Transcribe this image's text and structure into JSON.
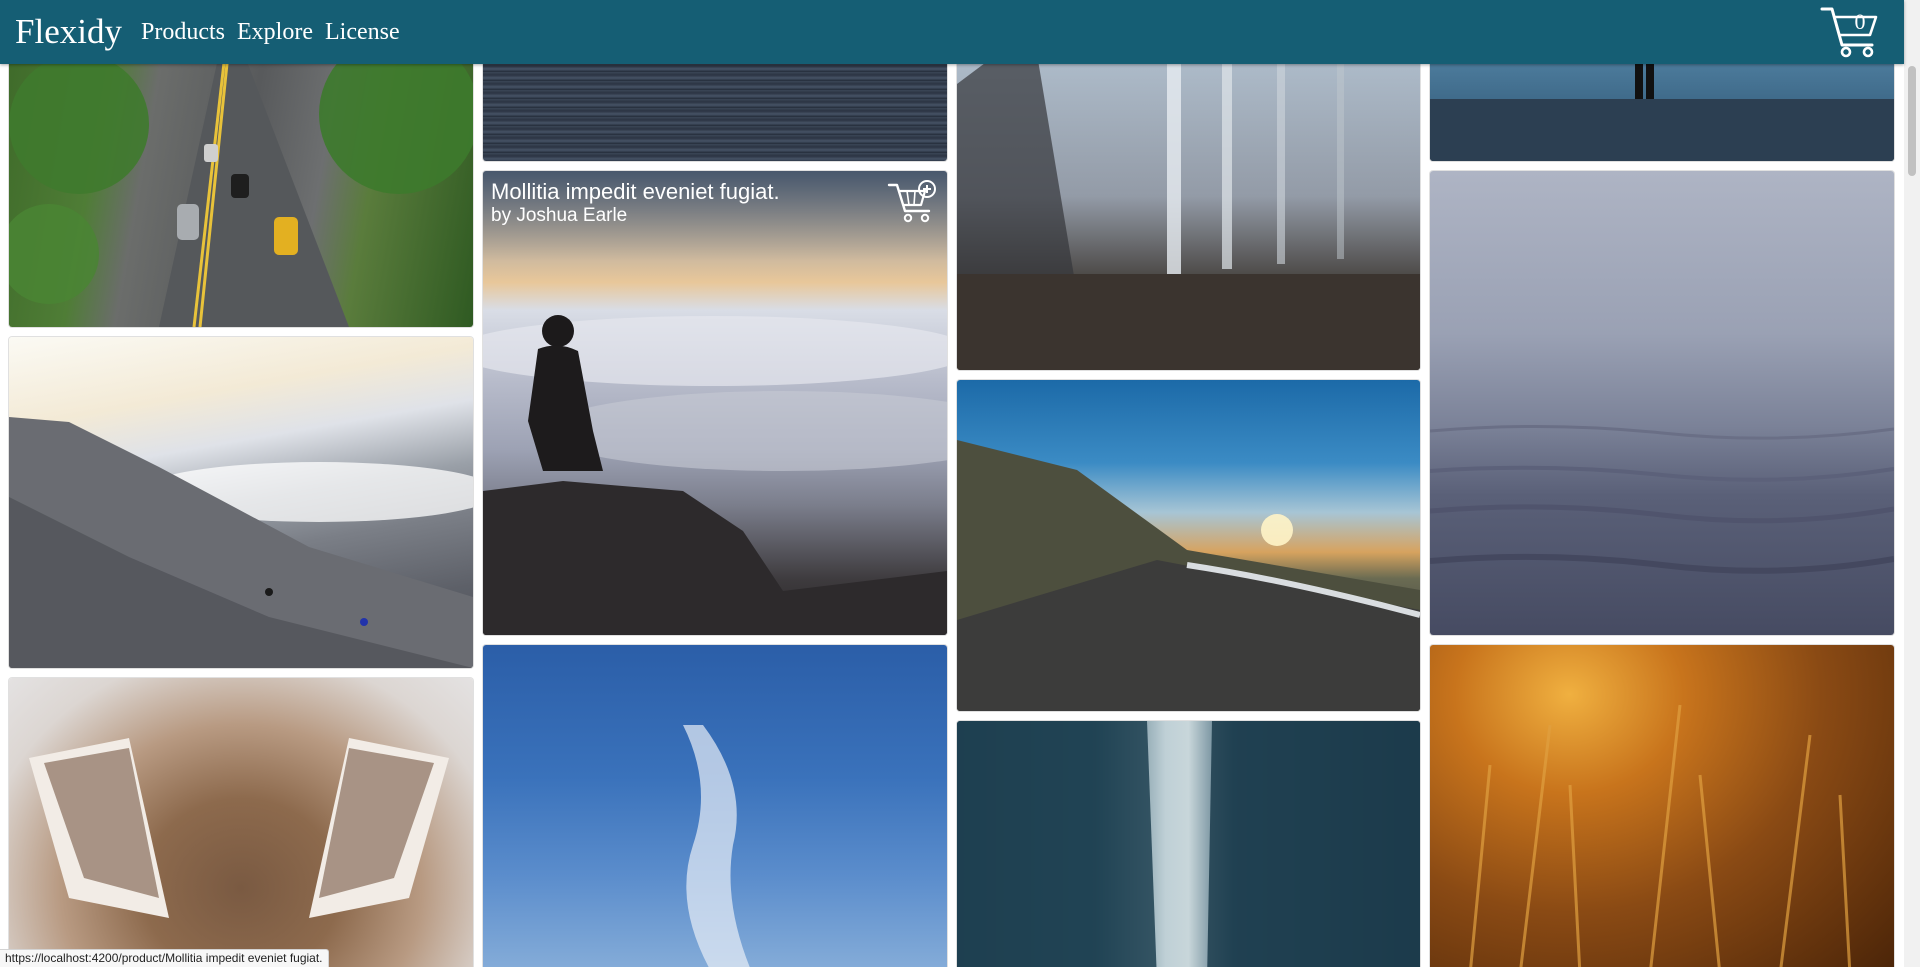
{
  "header": {
    "brand": "Flexidy",
    "nav": [
      "Products",
      "Explore",
      "License"
    ],
    "cart_count": "0",
    "background": "#155e74"
  },
  "gallery": {
    "featured_tile": {
      "title": "Mollitia impedit eveniet fugiat.",
      "author": "by Joshua Earle"
    },
    "tiles": [
      {
        "subject": "city street with trees and taxis",
        "column": 1
      },
      {
        "subject": "mountain climbers above clouds",
        "column": 1
      },
      {
        "subject": "fox ears close-up",
        "column": 1
      },
      {
        "subject": "dark striped abstract",
        "column": 2
      },
      {
        "subject": "person sitting above sea of clouds",
        "column": 2
      },
      {
        "subject": "blue sky with thin cloud",
        "column": 2
      },
      {
        "subject": "misty forest",
        "column": 3
      },
      {
        "subject": "winding road at sunset",
        "column": 3
      },
      {
        "subject": "city skyscrapers looking up",
        "column": 3
      },
      {
        "subject": "person standing at water edge",
        "column": 4
      },
      {
        "subject": "foggy sea waves",
        "column": 4
      },
      {
        "subject": "golden grass at sunset",
        "column": 4
      }
    ]
  },
  "status_url": "https://localhost:4200/product/Mollitia impedit eveniet fugiat.",
  "icons": {
    "cart": "cart-icon",
    "add_to_cart": "add-to-cart-icon"
  }
}
